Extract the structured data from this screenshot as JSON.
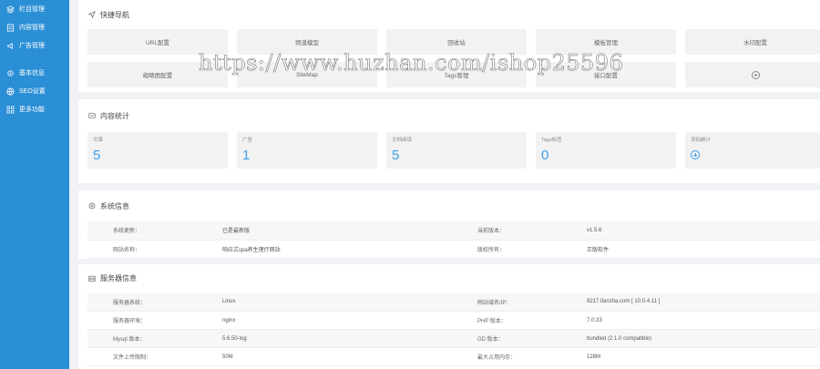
{
  "sidebar": {
    "items": [
      {
        "label": "栏目管理",
        "icon": "layers-icon"
      },
      {
        "label": "内容管理",
        "icon": "document-icon"
      },
      {
        "label": "广告管理",
        "icon": "megaphone-icon"
      },
      {
        "label": "基本信息",
        "icon": "gear-icon"
      },
      {
        "label": "SEO设置",
        "icon": "globe-icon"
      },
      {
        "label": "更多功能",
        "icon": "grid-icon"
      }
    ]
  },
  "quick_nav": {
    "title": "快捷导航",
    "items": [
      "URL配置",
      "频道模型",
      "回收站",
      "模板管理",
      "水印配置",
      "缩略图配置",
      "SiteMap",
      "Tags管理",
      "接口配置"
    ]
  },
  "content_stats": {
    "title": "内容统计",
    "items": [
      {
        "label": "文章",
        "value": "5"
      },
      {
        "label": "广告",
        "value": "1"
      },
      {
        "label": "文档阅读",
        "value": "5"
      },
      {
        "label": "Tags标签",
        "value": "0"
      }
    ],
    "add_label": "添加统计"
  },
  "system_info": {
    "title": "系统信息",
    "rows": [
      {
        "k1": "系统更新：",
        "v1": "已是最新版",
        "k2": "当前版本：",
        "v2": "v1.5.6"
      },
      {
        "k1": "网站名称：",
        "v1": "响应式spa养生理疗网站",
        "k2": "版权所有：",
        "v2": "正版软件"
      }
    ]
  },
  "server_info": {
    "title": "服务器信息",
    "rows": [
      {
        "k1": "服务器系统：",
        "v1": "Linux",
        "k2": "网站域名/IP：",
        "v2": "9217.ifanzha.com [ 10.0.4.11 ]"
      },
      {
        "k1": "服务器环境：",
        "v1": "nginx",
        "k2": "PHP 版本：",
        "v2": "7.0.33"
      },
      {
        "k1": "Mysql 版本：",
        "v1": "5.6.50-log",
        "k2": "GD 版本：",
        "v2": "bundled (2.1.0 compatible)"
      },
      {
        "k1": "文件上传限制：",
        "v1": "50M",
        "k2": "最大占用内存：",
        "v2": "128M"
      }
    ]
  },
  "watermark": "https://www.huzhan.com/ishop25596",
  "colors": {
    "sidebar": "#2b8fd6",
    "accent": "#3aa0e8",
    "background": "#f0f2f5"
  }
}
